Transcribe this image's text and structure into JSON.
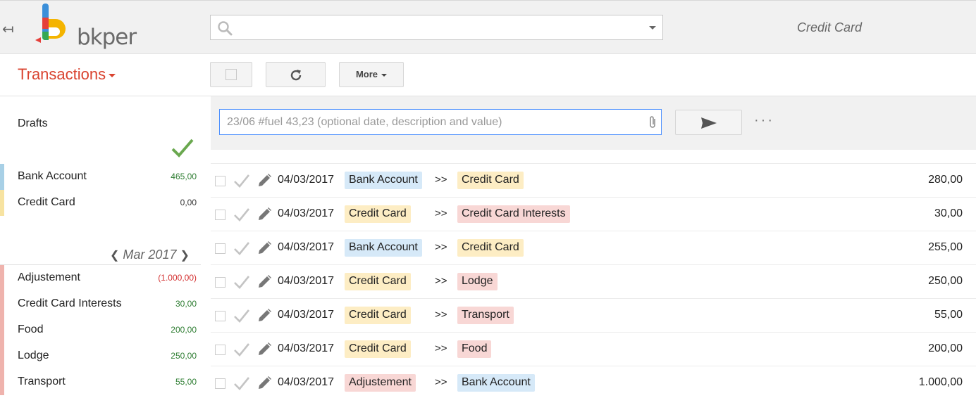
{
  "header": {
    "logo_text": "bkper",
    "book_title": "Credit Card",
    "search_placeholder": ""
  },
  "toolbar": {
    "section_title": "Transactions",
    "more_label": "More"
  },
  "entry": {
    "placeholder": "23/06 #fuel 43,23 (optional date, description and value)",
    "more_dots": "···"
  },
  "sidebar": {
    "drafts_label": "Drafts",
    "accounts": [
      {
        "name": "Bank Account",
        "value": "465,00",
        "stripe": "#a8d0e6",
        "value_color": "#2e7d32"
      },
      {
        "name": "Credit Card",
        "value": "0,00",
        "stripe": "#f7e3a1",
        "value_color": "#333333"
      }
    ],
    "period": "Mar 2017",
    "period_prev": "❮",
    "period_next": "❯",
    "groups": [
      {
        "name": "Adjustement",
        "value": "(1.000,00)",
        "value_color": "#d32f2f"
      },
      {
        "name": "Credit Card Interests",
        "value": "30,00",
        "value_color": "#2e7d32"
      },
      {
        "name": "Food",
        "value": "200,00",
        "value_color": "#2e7d32"
      },
      {
        "name": "Lodge",
        "value": "250,00",
        "value_color": "#2e7d32"
      },
      {
        "name": "Transport",
        "value": "55,00",
        "value_color": "#2e7d32"
      }
    ],
    "group_stripe": "#efb3ad"
  },
  "colors": {
    "asset": "#d6e9f8",
    "liability": "#fdedc4",
    "incoming": "#f8d7d5",
    "accent": "#d9432f"
  },
  "transactions": [
    {
      "date": "04/03/2017",
      "from": "Bank Account",
      "from_type": "asset",
      "sep": ">>",
      "to": "Credit Card",
      "to_type": "liability",
      "amount": "280,00"
    },
    {
      "date": "04/03/2017",
      "from": "Credit Card",
      "from_type": "liability",
      "sep": ">>",
      "to": "Credit Card Interests",
      "to_type": "incoming",
      "amount": "30,00"
    },
    {
      "date": "04/03/2017",
      "from": "Bank Account",
      "from_type": "asset",
      "sep": ">>",
      "to": "Credit Card",
      "to_type": "liability",
      "amount": "255,00"
    },
    {
      "date": "04/03/2017",
      "from": "Credit Card",
      "from_type": "liability",
      "sep": ">>",
      "to": "Lodge",
      "to_type": "incoming",
      "amount": "250,00"
    },
    {
      "date": "04/03/2017",
      "from": "Credit Card",
      "from_type": "liability",
      "sep": ">>",
      "to": "Transport",
      "to_type": "incoming",
      "amount": "55,00"
    },
    {
      "date": "04/03/2017",
      "from": "Credit Card",
      "from_type": "liability",
      "sep": ">>",
      "to": "Food",
      "to_type": "incoming",
      "amount": "200,00"
    },
    {
      "date": "04/03/2017",
      "from": "Adjustement",
      "from_type": "incoming",
      "sep": ">>",
      "to": "Bank Account",
      "to_type": "asset",
      "amount": "1.000,00"
    }
  ]
}
